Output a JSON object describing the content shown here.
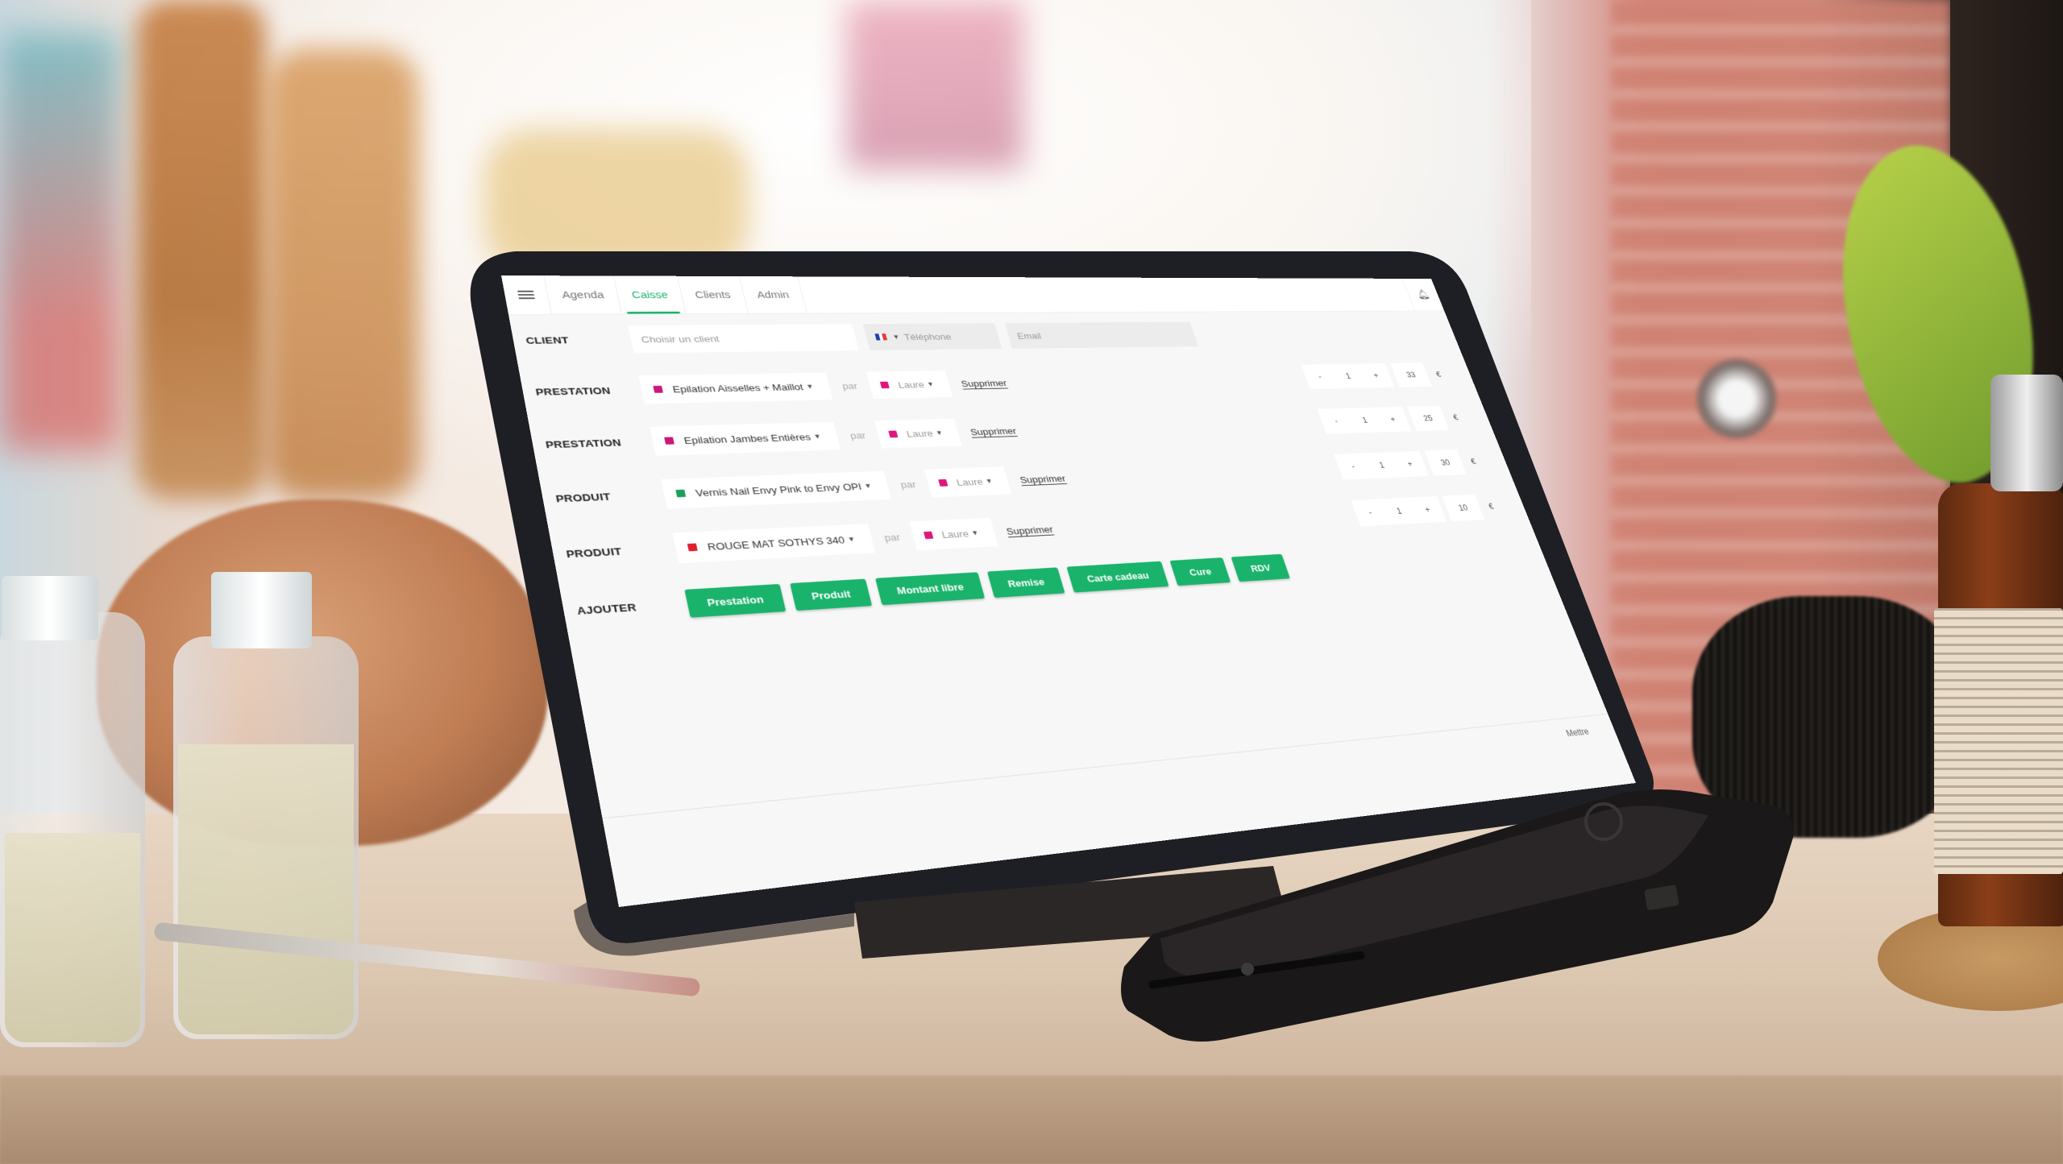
{
  "app": {
    "tabs": [
      {
        "label": "Agenda",
        "active": false
      },
      {
        "label": "Caisse",
        "active": true
      },
      {
        "label": "Clients",
        "active": false
      },
      {
        "label": "Admin",
        "active": false
      }
    ],
    "icons": {
      "menu": "hamburger-menu-icon",
      "notifications": "bell-icon"
    }
  },
  "client": {
    "label": "CLIENT",
    "client_placeholder": "Choisir un client",
    "phone_country": "FR",
    "phone_placeholder": "Téléphone",
    "email_placeholder": "Email"
  },
  "lines": [
    {
      "type": "PRESTATION",
      "item": "Epilation Aisselles + Maillot",
      "item_color": "#d0157a",
      "par": "par",
      "staff": "Laure",
      "staff_color": "#e0167e",
      "delete": "Supprimer",
      "minus": "-",
      "qty": "1",
      "plus": "+",
      "price": "33",
      "currency": "€"
    },
    {
      "type": "PRESTATION",
      "item": "Epilation Jambes Entières",
      "item_color": "#d0157a",
      "par": "par",
      "staff": "Laure",
      "staff_color": "#e0167e",
      "delete": "Supprimer",
      "minus": "-",
      "qty": "1",
      "plus": "+",
      "price": "25",
      "currency": "€"
    },
    {
      "type": "PRODUIT",
      "item": "Vernis Nail Envy Pink to Envy OPI",
      "item_color": "#1a9f5a",
      "par": "par",
      "staff": "Laure",
      "staff_color": "#e0167e",
      "delete": "Supprimer",
      "minus": "-",
      "qty": "1",
      "plus": "+",
      "price": "30",
      "currency": "€"
    },
    {
      "type": "PRODUIT",
      "item": "ROUGE MAT SOTHYS 340",
      "item_color": "#e0202e",
      "par": "par",
      "staff": "Laure",
      "staff_color": "#e0167e",
      "delete": "Supprimer",
      "minus": "-",
      "qty": "1",
      "plus": "+",
      "price": "10",
      "currency": "€"
    }
  ],
  "add": {
    "label": "AJOUTER",
    "buttons": [
      "Prestation",
      "Produit",
      "Montant libre",
      "Remise",
      "Carte cadeau",
      "Cure",
      "RDV"
    ],
    "accent": "#1ab36b"
  },
  "footer": {
    "text": "Mettre"
  }
}
